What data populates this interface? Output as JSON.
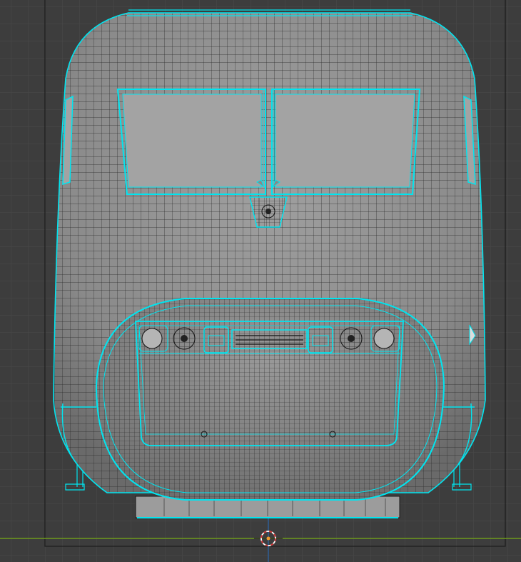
{
  "viewport": {
    "colors": {
      "background": "#3d3d3d",
      "grid": "#474747",
      "x_axis": "#6e9a1c",
      "z_axis": "#2f5f96",
      "selection": "#00e5f0",
      "mesh_face": "#8e8e8e",
      "window_face": "#a3a3a3",
      "cursor_red": "#d03030"
    }
  }
}
